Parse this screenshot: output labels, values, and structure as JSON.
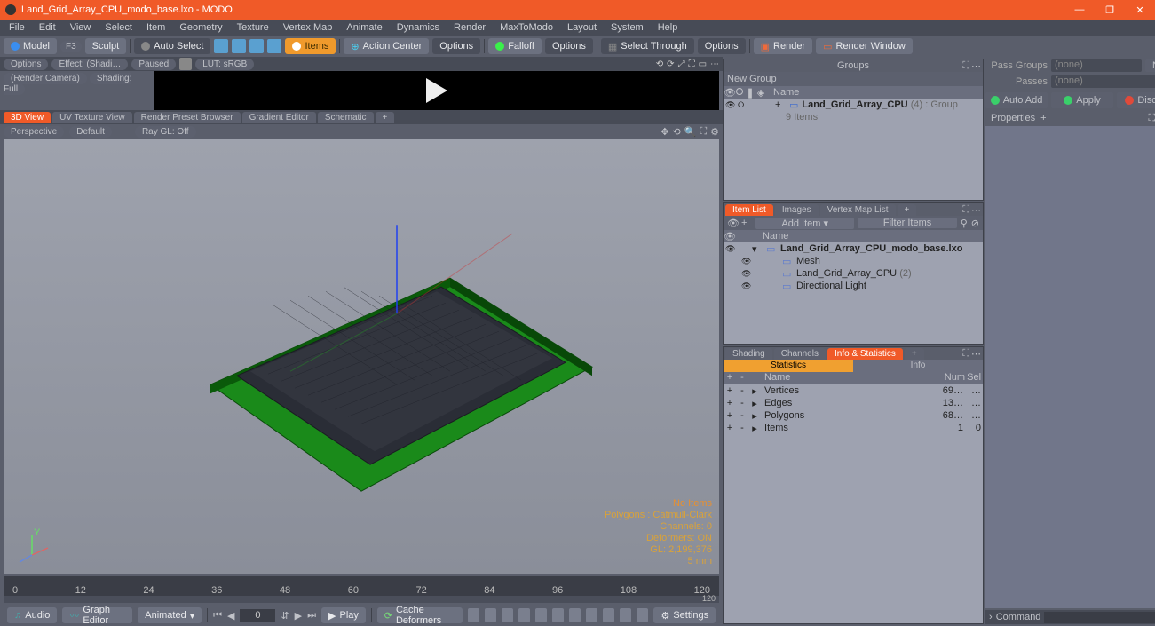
{
  "app": {
    "title": "Land_Grid_Array_CPU_modo_base.lxo - MODO"
  },
  "win_btns": {
    "min": "—",
    "max": "❐",
    "close": "✕"
  },
  "menu": [
    "File",
    "Edit",
    "View",
    "Select",
    "Item",
    "Geometry",
    "Texture",
    "Vertex Map",
    "Animate",
    "Dynamics",
    "Render",
    "MaxToModo",
    "Layout",
    "System",
    "Help"
  ],
  "toolbar": {
    "model": "Model",
    "f3": "F3",
    "sculpt": "Sculpt",
    "autoselect": "Auto Select",
    "items": "Items",
    "actioncenter": "Action Center",
    "options1": "Options",
    "falloff": "Falloff",
    "options2": "Options",
    "selectthrough": "Select Through",
    "options3": "Options",
    "render": "Render",
    "renderwindow": "Render Window"
  },
  "preview": {
    "options": "Options",
    "effect": "Effect: (Shadi…",
    "paused": "Paused",
    "lut": "LUT: sRGB",
    "rendercam": "(Render Camera)",
    "shading": "Shading: Full"
  },
  "vp_tabs": [
    "3D View",
    "UV Texture View",
    "Render Preset Browser",
    "Gradient Editor",
    "Schematic",
    "+"
  ],
  "vp_toolbar": {
    "perspective": "Perspective",
    "default": "Default",
    "raygl": "Ray GL: Off"
  },
  "vp_info": {
    "noitems": "No Items",
    "polys": "Polygons : Catmull-Clark",
    "channels": "Channels: 0",
    "deformers": "Deformers: ON",
    "gl": "GL: 2,199,376",
    "units": "5 mm"
  },
  "timeline_ticks": [
    "0",
    "12",
    "24",
    "36",
    "48",
    "60",
    "72",
    "84",
    "96",
    "108",
    "120"
  ],
  "timeline_end": "120",
  "bottombar": {
    "audio": "Audio",
    "grapheditor": "Graph Editor",
    "animated": "Animated",
    "frame": "0",
    "play": "Play",
    "cachedeformers": "Cache Deformers",
    "settings": "Settings"
  },
  "groups": {
    "title": "Groups",
    "newgroup": "New Group",
    "cols": "Name",
    "root": "Land_Grid_Array_CPU",
    "root_suffix": "(4) : Group",
    "child": "9 Items"
  },
  "itemlist": {
    "tabs": [
      "Item List",
      "Images",
      "Vertex Map List",
      "+"
    ],
    "additem": "Add Item",
    "filter": "Filter Items",
    "cols": "Name",
    "rows": [
      {
        "name": "Land_Grid_Array_CPU_modo_base.lxo",
        "bold": true,
        "indent": 0
      },
      {
        "name": "Mesh",
        "indent": 1
      },
      {
        "name": "Land_Grid_Array_CPU",
        "suffix": "(2)",
        "indent": 1
      },
      {
        "name": "Directional Light",
        "indent": 1
      }
    ]
  },
  "info": {
    "tabs": [
      "Shading",
      "Channels",
      "Info & Statistics",
      "+"
    ],
    "subtabs": {
      "stats": "Statistics",
      "info": "Info"
    },
    "head": {
      "name": "Name",
      "num": "Num",
      "sel": "Sel"
    },
    "rows": [
      {
        "name": "Vertices",
        "num": "69…",
        "sel": "…"
      },
      {
        "name": "Edges",
        "num": "13…",
        "sel": "…"
      },
      {
        "name": "Polygons",
        "num": "68…",
        "sel": "…"
      },
      {
        "name": "Items",
        "num": "1",
        "sel": "0"
      }
    ]
  },
  "far": {
    "passgroups_lbl": "Pass Groups",
    "passgroups_val": "(none)",
    "new": "New",
    "passes_lbl": "Passes",
    "passes_val": "(none)",
    "autoadd": "Auto Add",
    "apply": "Apply",
    "discard": "Discard",
    "props": "Properties",
    "cmd_lbl": "Command"
  }
}
